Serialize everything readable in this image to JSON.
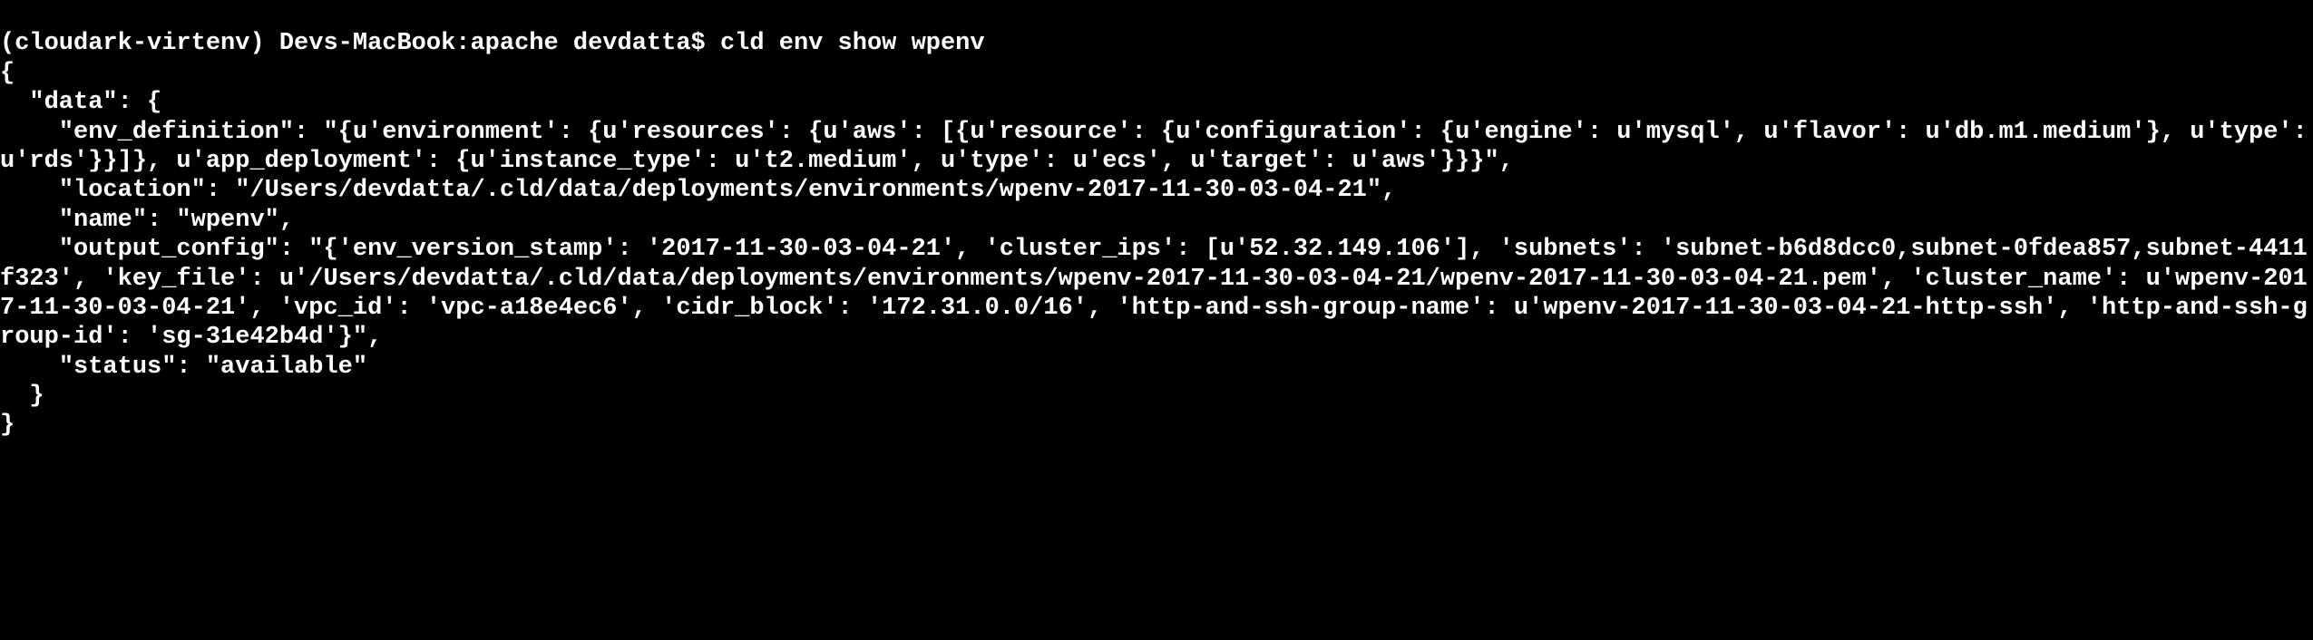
{
  "prompt": "(cloudark-virtenv) Devs-MacBook:apache devdatta$ ",
  "command": "cld env show wpenv",
  "output_lines": [
    "{",
    "  \"data\": {",
    "    \"env_definition\": \"{u'environment': {u'resources': {u'aws': [{u'resource': {u'configuration': {u'engine': u'mysql', u'flavor': u'db.m1.medium'}, u'type': u'rds'}}]}, u'app_deployment': {u'instance_type': u't2.medium', u'type': u'ecs', u'target': u'aws'}}}\",",
    "    \"location\": \"/Users/devdatta/.cld/data/deployments/environments/wpenv-2017-11-30-03-04-21\",",
    "    \"name\": \"wpenv\",",
    "    \"output_config\": \"{'env_version_stamp': '2017-11-30-03-04-21', 'cluster_ips': [u'52.32.149.106'], 'subnets': 'subnet-b6d8dcc0,subnet-0fdea857,subnet-4411f323', 'key_file': u'/Users/devdatta/.cld/data/deployments/environments/wpenv-2017-11-30-03-04-21/wpenv-2017-11-30-03-04-21.pem', 'cluster_name': u'wpenv-2017-11-30-03-04-21', 'vpc_id': 'vpc-a18e4ec6', 'cidr_block': '172.31.0.0/16', 'http-and-ssh-group-name': u'wpenv-2017-11-30-03-04-21-http-ssh', 'http-and-ssh-group-id': 'sg-31e42b4d'}\",",
    "    \"status\": \"available\"",
    "  }",
    "}"
  ]
}
